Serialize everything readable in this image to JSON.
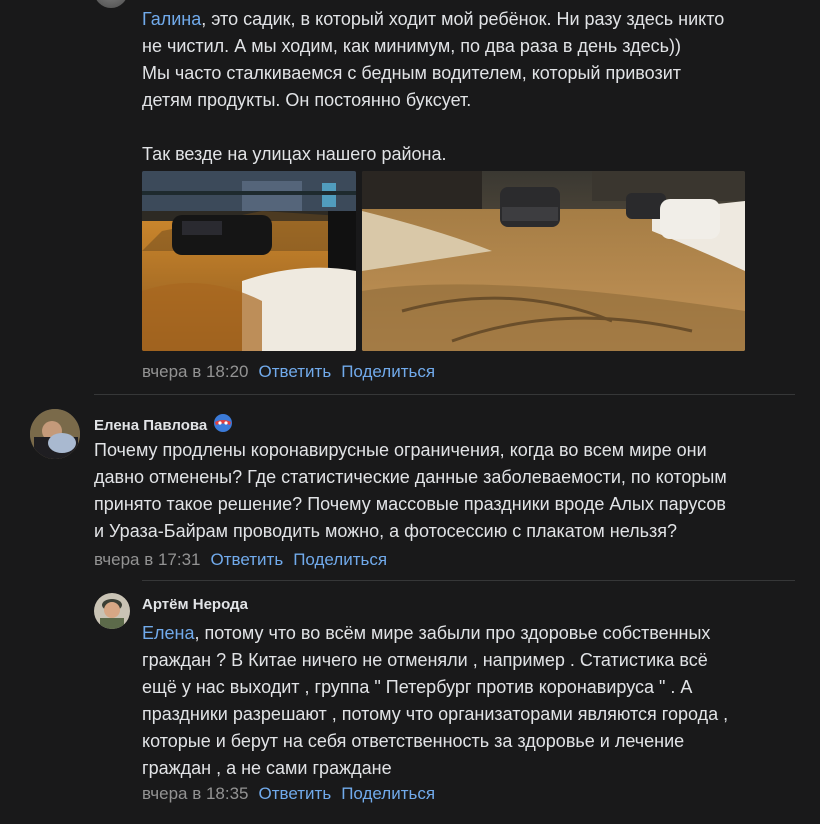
{
  "comments": [
    {
      "id": "c1",
      "mention": "Галина",
      "text_after_mention": ", это садик, в который ходит мой ребёнок. Ни разу здесь никто\nне чистил. А мы ходим, как минимум, по два раза в день здесь))\nМы часто сталкиваемся с бедным водителем, который привозит\nдетям продукты. Он постоянно буксует.\n\nТак везде на улицах нашего района.",
      "time": "вчера в 18:20",
      "reply_label": "Ответить",
      "share_label": "Поделиться",
      "photos": [
        "snowy-kindergarten-parking-night-photo",
        "slushy-street-parked-cars-photo"
      ]
    },
    {
      "id": "c2",
      "author": "Елена Павлова",
      "badge_icon": "superhero-mask-emoji-icon",
      "text": "Почему продлены коронавирусные ограничения, когда во всем мире они\nдавно отменены? Где статистические данные заболеваемости, по которым\nпринято такое решение? Почему массовые праздники вроде Алых парусов\nи Ураза-Байрам проводить можно, а фотосессию с плакатом нельзя?",
      "time": "вчера в 17:31",
      "reply_label": "Ответить",
      "share_label": "Поделиться"
    },
    {
      "id": "c3",
      "author": "Артём Нерода",
      "mention": "Елена",
      "text_after_mention": ", потому что во всём мире забыли про здоровье собственных\nграждан ? В Китае ничего не отменяли , например . Статистика всё\nещё у нас выходит , группа \" Петербург против коронавируса \" . А\nпраздники разрешают , потому что организаторами являются города ,\nкоторые и берут на себя ответственность за здоровье и лечение\nграждан , а не сами граждане",
      "time": "вчера в 18:35",
      "reply_label": "Ответить",
      "share_label": "Поделиться"
    }
  ],
  "colors": {
    "background": "#19191a",
    "text": "#e1e3e6",
    "link": "#71aaeb",
    "meta": "#939393",
    "divider": "#363738"
  }
}
